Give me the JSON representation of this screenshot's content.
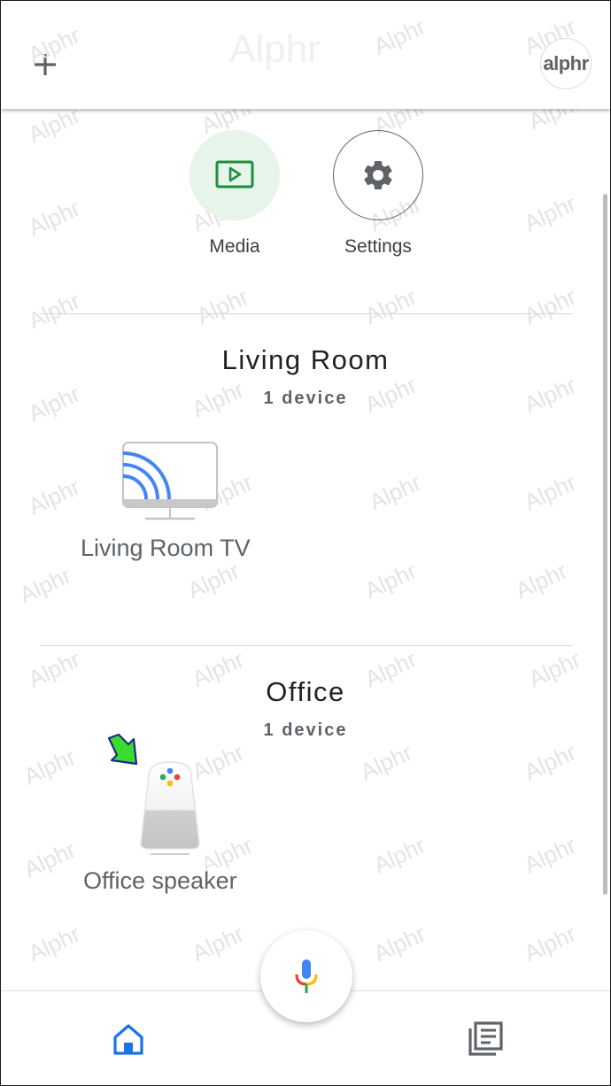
{
  "header": {
    "add_icon": "plus-icon",
    "avatar_text": "alphr"
  },
  "watermark": {
    "text": "Alphr"
  },
  "quick_actions": [
    {
      "label": "Media",
      "icon": "media-icon"
    },
    {
      "label": "Settings",
      "icon": "gear-icon"
    }
  ],
  "rooms": [
    {
      "name": "Living Room",
      "count": "1 device",
      "device": {
        "label": "Living Room TV",
        "icon": "cast-tv-icon"
      }
    },
    {
      "name": "Office",
      "count": "1 device",
      "device": {
        "label": "Office speaker",
        "icon": "smart-speaker-icon"
      }
    }
  ],
  "bottom_nav": {
    "home_icon": "home-icon",
    "mic_icon": "mic-icon",
    "feed_icon": "feed-icon"
  },
  "colors": {
    "accent": "#1a73e8",
    "media_bg": "#e6f4ea",
    "media_icon": "#1e8e3e",
    "arrow": "#3cdc2c"
  }
}
